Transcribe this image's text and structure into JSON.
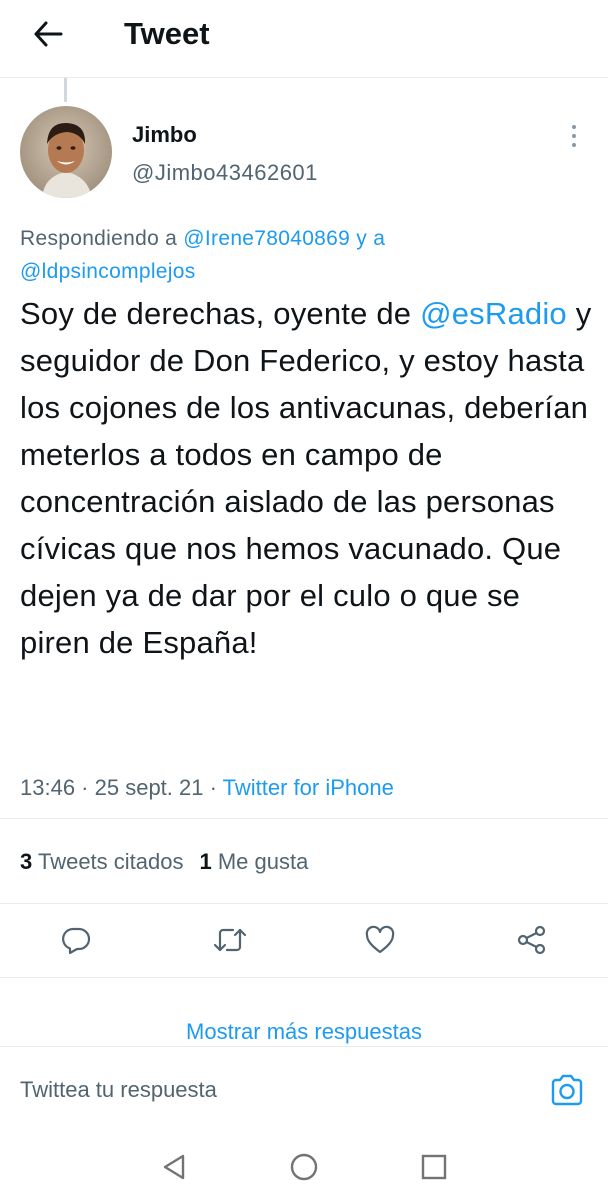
{
  "header": {
    "title": "Tweet",
    "back_icon": "arrow-left-icon"
  },
  "tweet": {
    "author": {
      "name": "Jimbo",
      "handle": "@Jimbo43462601",
      "avatar_icon": "user-avatar-photo"
    },
    "replying": {
      "prefix": "Respondiendo a ",
      "handle1": "@Irene78040869",
      "connector": " y a",
      "handle2": "@ldpsincomplejos"
    },
    "text": {
      "part1": "Soy de derechas, oyente de ",
      "mention": "@esRadio",
      "part2": " y seguidor de Don Federico, y estoy hasta los cojones de los antivacunas, deberían meterlos a todos en campo de concentración aislado de las personas cívicas que nos hemos vacunado. Que dejen ya de dar por el culo o que se piren de España!"
    },
    "meta": {
      "time": "13:46",
      "sep1": " · ",
      "date": "25 sept. 21",
      "sep2": " · ",
      "source": "Twitter for iPhone"
    },
    "stats": {
      "quotes_count": "3",
      "quotes_label": " Tweets citados",
      "likes_count": "1",
      "likes_label": " Me gusta"
    },
    "actions": [
      "reply-icon",
      "retweet-icon",
      "like-icon",
      "share-icon"
    ]
  },
  "more_replies": "Mostrar más respuestas",
  "reply_bar": {
    "placeholder": "Twittea tu respuesta",
    "camera_icon": "camera-icon"
  },
  "android_nav": [
    "back-triangle-icon",
    "home-circle-icon",
    "recents-square-icon"
  ],
  "colors": {
    "accent": "#1d9bf0",
    "text": "#0f1419",
    "secondary": "#536471",
    "border": "#e6ecf0"
  }
}
